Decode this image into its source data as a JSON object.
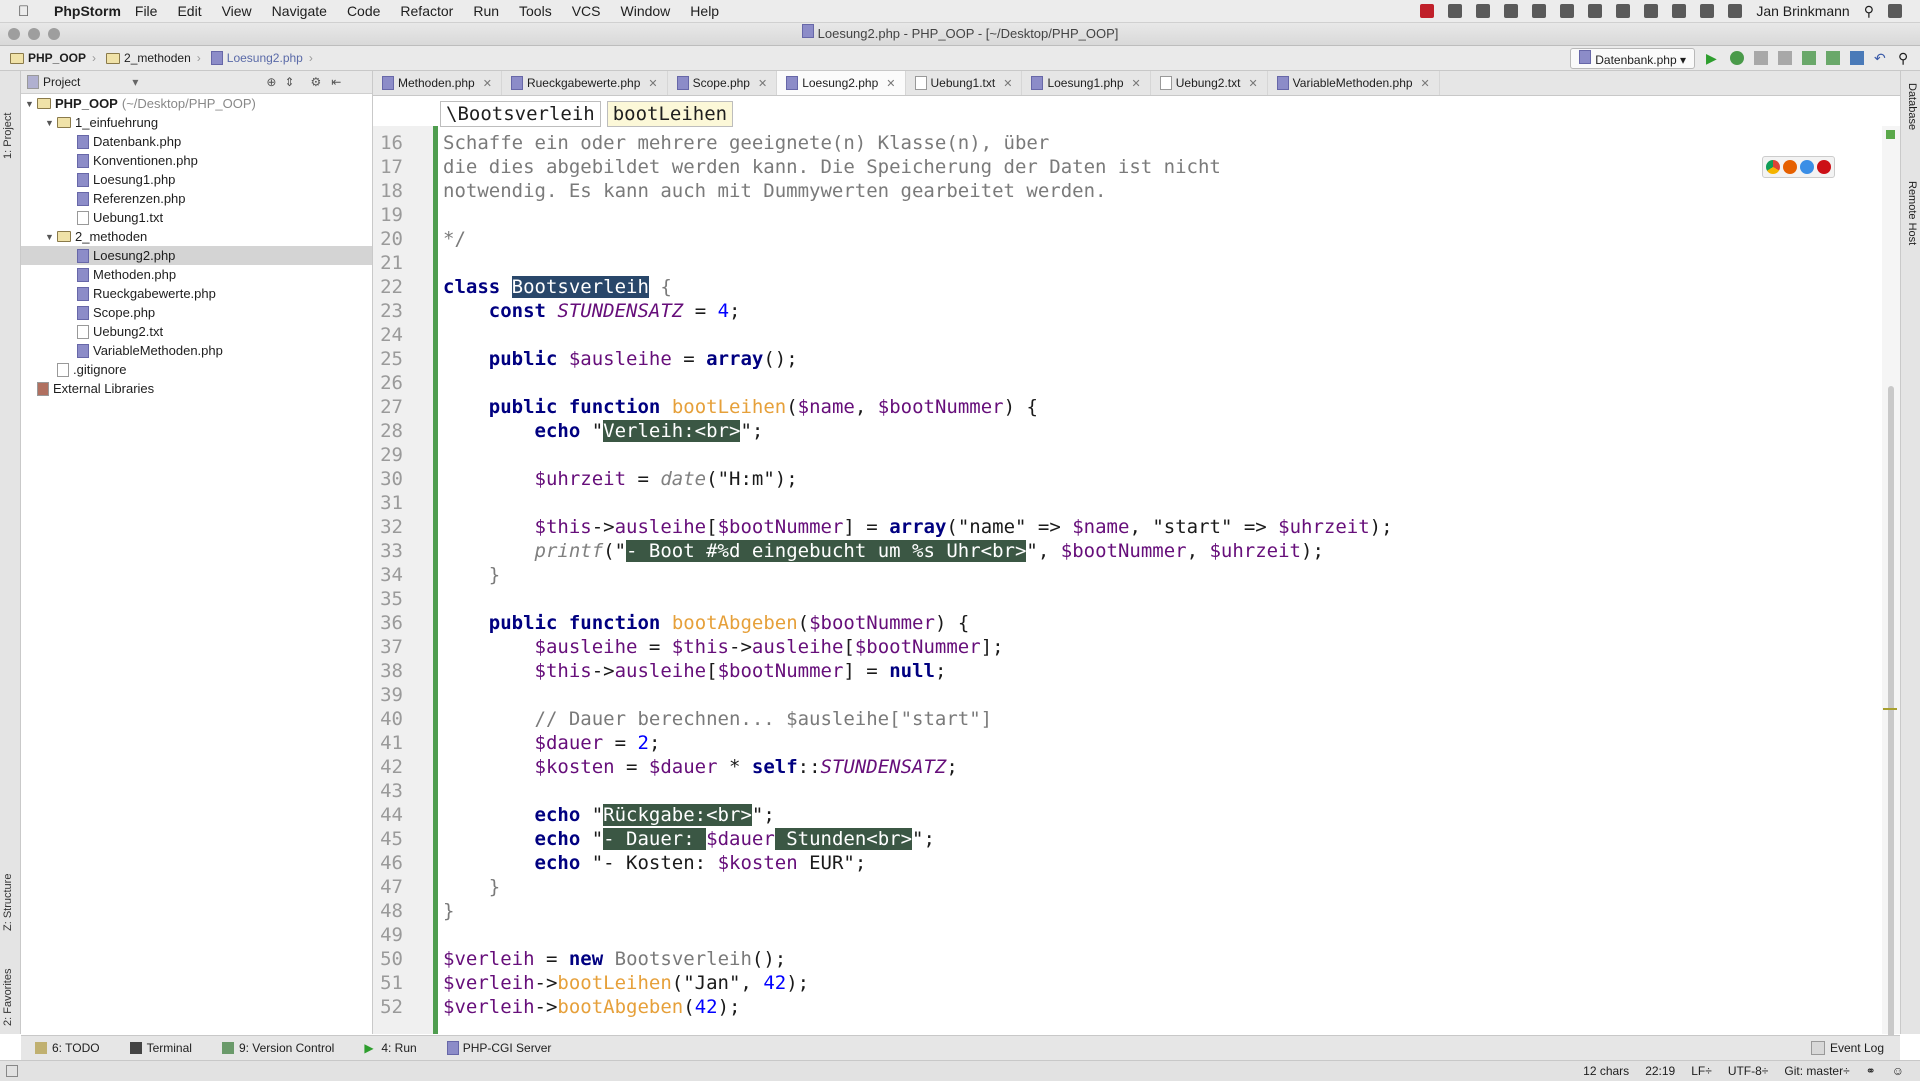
{
  "menubar": {
    "app": "PhpStorm",
    "items": [
      "File",
      "Edit",
      "View",
      "Navigate",
      "Code",
      "Refactor",
      "Run",
      "Tools",
      "VCS",
      "Window",
      "Help"
    ],
    "user": "Jan Brinkmann"
  },
  "window": {
    "title": "Loesung2.php - PHP_OOP - [~/Desktop/PHP_OOP]"
  },
  "breadcrumb": [
    "PHP_OOP",
    "2_methoden",
    "Loesung2.php"
  ],
  "run_config": "Datenbank.php",
  "project_panel": {
    "header": "Project",
    "tree": [
      {
        "label": "PHP_OOP",
        "extra": "(~/Desktop/PHP_OOP)",
        "indent": 0,
        "type": "folder",
        "expanded": true,
        "bold": true
      },
      {
        "label": "1_einfuehrung",
        "indent": 1,
        "type": "folder",
        "expanded": true
      },
      {
        "label": "Datenbank.php",
        "indent": 2,
        "type": "php"
      },
      {
        "label": "Konventionen.php",
        "indent": 2,
        "type": "php"
      },
      {
        "label": "Loesung1.php",
        "indent": 2,
        "type": "php"
      },
      {
        "label": "Referenzen.php",
        "indent": 2,
        "type": "php"
      },
      {
        "label": "Uebung1.txt",
        "indent": 2,
        "type": "txt"
      },
      {
        "label": "2_methoden",
        "indent": 1,
        "type": "folder",
        "expanded": true
      },
      {
        "label": "Loesung2.php",
        "indent": 2,
        "type": "php",
        "selected": true
      },
      {
        "label": "Methoden.php",
        "indent": 2,
        "type": "php"
      },
      {
        "label": "Rueckgabewerte.php",
        "indent": 2,
        "type": "php"
      },
      {
        "label": "Scope.php",
        "indent": 2,
        "type": "php"
      },
      {
        "label": "Uebung2.txt",
        "indent": 2,
        "type": "txt"
      },
      {
        "label": "VariableMethoden.php",
        "indent": 2,
        "type": "php"
      },
      {
        "label": ".gitignore",
        "indent": 1,
        "type": "txt"
      },
      {
        "label": "External Libraries",
        "indent": 0,
        "type": "lib"
      }
    ]
  },
  "left_tabs": [
    "1: Project",
    "Z: Structure",
    "2: Favorites"
  ],
  "right_tabs": [
    "Database",
    "Remote Host"
  ],
  "editor_tabs": [
    {
      "label": "Methoden.php",
      "type": "php"
    },
    {
      "label": "Rueckgabewerte.php",
      "type": "php"
    },
    {
      "label": "Scope.php",
      "type": "php"
    },
    {
      "label": "Loesung2.php",
      "type": "php",
      "active": true
    },
    {
      "label": "Uebung1.txt",
      "type": "txt"
    },
    {
      "label": "Loesung1.php",
      "type": "php"
    },
    {
      "label": "Uebung2.txt",
      "type": "txt"
    },
    {
      "label": "VariableMethoden.php",
      "type": "php"
    }
  ],
  "editor_breadcrumb": [
    "\\Bootsverleih",
    "bootLeihen"
  ],
  "code_lines": [
    {
      "n": 16,
      "html": "<span class=\"cmt\">Schaffe ein oder mehrere geeignete(n) Klasse(n), über</span>"
    },
    {
      "n": 17,
      "html": "<span class=\"cmt\">die dies abgebildet werden kann. Die Speicherung der Daten ist nicht</span>"
    },
    {
      "n": 18,
      "html": "<span class=\"cmt\">notwendig. Es kann auch mit Dummywerten gearbeitet werden.</span>"
    },
    {
      "n": 19,
      "html": ""
    },
    {
      "n": 20,
      "html": "<span class=\"cmt\">*/</span>"
    },
    {
      "n": 21,
      "html": ""
    },
    {
      "n": 22,
      "html": "<span class=\"kw\">class</span> <span class=\"hl\">Bootsverleih</span> <span class=\"cmt\">{</span>"
    },
    {
      "n": 23,
      "html": "    <span class=\"kw\">const</span> <span class=\"const\">STUNDENSATZ</span> = <span class=\"num\">4</span>;"
    },
    {
      "n": 24,
      "html": ""
    },
    {
      "n": 25,
      "html": "    <span class=\"kw\">public</span> <span class=\"var\">$ausleihe</span> = <span class=\"kw\">array</span>();"
    },
    {
      "n": 26,
      "html": ""
    },
    {
      "n": 27,
      "html": "    <span class=\"kw\">public function</span> <span class=\"fn\">bootLeihen</span>(<span class=\"var\">$name</span>, <span class=\"var\">$bootNummer</span>) {"
    },
    {
      "n": 28,
      "html": "        <span class=\"kw\">echo</span> \"<span class=\"hs\">Verleih:&lt;br&gt;</span>\";"
    },
    {
      "n": 29,
      "html": ""
    },
    {
      "n": 30,
      "html": "        <span class=\"var\">$uhrzeit</span> = <span class=\"glob\">date</span>(\"H:m\");"
    },
    {
      "n": 31,
      "html": ""
    },
    {
      "n": 32,
      "html": "        <span class=\"var\">$this</span>-><span class=\"prop\">ausleihe</span>[<span class=\"var\">$bootNummer</span>] = <span class=\"kw\">array</span>(\"name\" => <span class=\"var\">$name</span>, \"start\" => <span class=\"var\">$uhrzeit</span>);"
    },
    {
      "n": 33,
      "html": "        <span class=\"glob\">printf</span>(\"<span class=\"hs\">- Boot #%d eingebucht um %s Uhr&lt;br&gt;</span>\", <span class=\"var\">$bootNummer</span>, <span class=\"var\">$uhrzeit</span>);"
    },
    {
      "n": 34,
      "html": "    <span class=\"cmt\">}</span>"
    },
    {
      "n": 35,
      "html": ""
    },
    {
      "n": 36,
      "html": "    <span class=\"kw\">public function</span> <span class=\"fn\">bootAbgeben</span>(<span class=\"var\">$bootNummer</span>) {"
    },
    {
      "n": 37,
      "html": "        <span class=\"var\">$ausleihe</span> = <span class=\"var\">$this</span>-><span class=\"prop\">ausleihe</span>[<span class=\"var\">$bootNummer</span>];"
    },
    {
      "n": 38,
      "html": "        <span class=\"var\">$this</span>-><span class=\"prop\">ausleihe</span>[<span class=\"var\">$bootNummer</span>] = <span class=\"kw\">null</span>;"
    },
    {
      "n": 39,
      "html": ""
    },
    {
      "n": 40,
      "html": "        <span class=\"cmt\">// Dauer berechnen... $ausleihe[\"start\"]</span>"
    },
    {
      "n": 41,
      "html": "        <span class=\"var\">$dauer</span> = <span class=\"num\">2</span>;"
    },
    {
      "n": 42,
      "html": "        <span class=\"var\">$kosten</span> = <span class=\"var\">$dauer</span> * <span class=\"kw\">self</span>::<span class=\"const\">STUNDENSATZ</span>;"
    },
    {
      "n": 43,
      "html": ""
    },
    {
      "n": 44,
      "html": "        <span class=\"kw\">echo</span> \"<span class=\"hs\">Rückgabe:&lt;br&gt;</span>\";"
    },
    {
      "n": 45,
      "html": "        <span class=\"kw\">echo</span> \"<span class=\"hs\">- Dauer: </span><span class=\"var\">$dauer</span><span class=\"hs\"> Stunden&lt;br&gt;</span>\";"
    },
    {
      "n": 46,
      "html": "        <span class=\"kw\">echo</span> \"- Kosten: <span class=\"var\">$kosten</span> EUR\";"
    },
    {
      "n": 47,
      "html": "    <span class=\"cmt\">}</span>"
    },
    {
      "n": 48,
      "html": "<span class=\"cmt\">}</span>"
    },
    {
      "n": 49,
      "html": ""
    },
    {
      "n": 50,
      "html": "<span class=\"var\">$verleih</span> = <span class=\"kw\">new</span> <span class=\"cmt\">Bootsverleih</span>();"
    },
    {
      "n": 51,
      "html": "<span class=\"var\">$verleih</span>-><span class=\"fn\">bootLeihen</span>(\"Jan\", <span class=\"num\">42</span>);"
    },
    {
      "n": 52,
      "html": "<span class=\"var\">$verleih</span>-><span class=\"fn\">bootAbgeben</span>(<span class=\"num\">42</span>);"
    }
  ],
  "tool_windows": [
    {
      "label": "6: TODO"
    },
    {
      "label": "Terminal"
    },
    {
      "label": "9: Version Control"
    },
    {
      "label": "4: Run"
    },
    {
      "label": "PHP-CGI Server"
    }
  ],
  "event_log": "Event Log",
  "status": {
    "chars": "12 chars",
    "position": "22:19",
    "line_sep": "LF÷",
    "encoding": "UTF-8÷",
    "git": "Git: master÷"
  },
  "colors": {
    "keyword": "#000080",
    "variable": "#660e7a",
    "function": "#e6a03a",
    "selection": "#29476a",
    "string_highlight": "#3b5744",
    "change_marker": "#4f9d4f"
  }
}
